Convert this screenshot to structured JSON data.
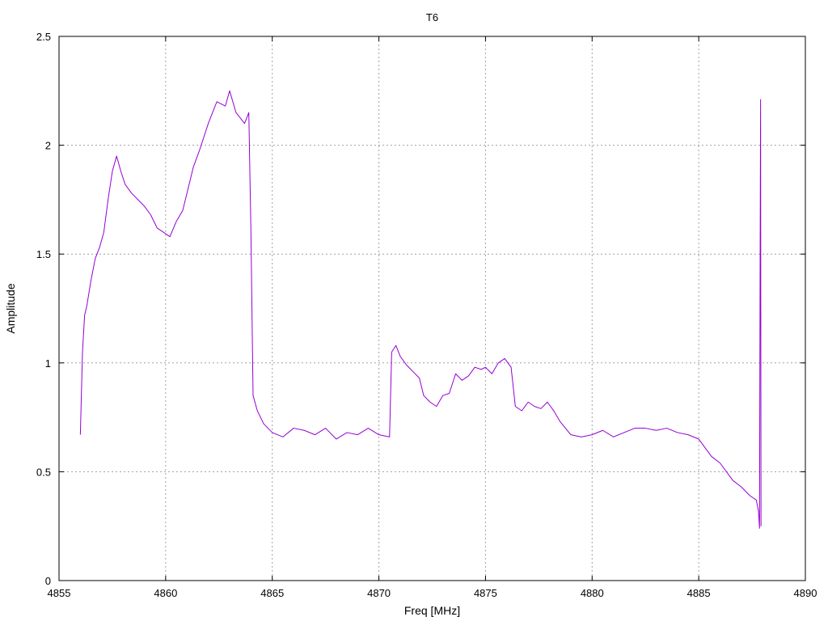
{
  "chart_data": {
    "type": "line",
    "title": "T6",
    "xlabel": "Freq [MHz]",
    "ylabel": "Amplitude",
    "xlim": [
      4855,
      4890
    ],
    "ylim": [
      0,
      2.5
    ],
    "xticks": [
      4855,
      4860,
      4865,
      4870,
      4875,
      4880,
      4885,
      4890
    ],
    "yticks": [
      0,
      0.5,
      1,
      1.5,
      2,
      2.5
    ],
    "xtick_labels": [
      "4855",
      "4860",
      "4865",
      "4870",
      "4875",
      "4880",
      "4885",
      "4890"
    ],
    "ytick_labels": [
      "0",
      "0.5",
      "1",
      "1.5",
      "2",
      "2.5"
    ],
    "grid": true,
    "legend": "none",
    "series": [
      {
        "color": "#9400d3",
        "x": [
          4856.0,
          4856.1,
          4856.2,
          4856.3,
          4856.5,
          4856.7,
          4856.9,
          4857.1,
          4857.3,
          4857.5,
          4857.7,
          4857.9,
          4858.1,
          4858.4,
          4858.7,
          4859.0,
          4859.3,
          4859.6,
          4859.9,
          4860.2,
          4860.5,
          4860.8,
          4861.0,
          4861.3,
          4861.6,
          4862.0,
          4862.4,
          4862.8,
          4863.0,
          4863.3,
          4863.7,
          4863.9,
          4864.0,
          4864.1,
          4864.3,
          4864.6,
          4865.0,
          4865.5,
          4866.0,
          4866.5,
          4867.0,
          4867.5,
          4868.0,
          4868.5,
          4869.0,
          4869.5,
          4870.0,
          4870.5,
          4870.6,
          4870.8,
          4871.0,
          4871.3,
          4871.6,
          4871.9,
          4872.1,
          4872.4,
          4872.7,
          4873.0,
          4873.3,
          4873.6,
          4873.9,
          4874.2,
          4874.5,
          4874.8,
          4875.0,
          4875.3,
          4875.6,
          4875.9,
          4876.2,
          4876.4,
          4876.7,
          4877.0,
          4877.3,
          4877.6,
          4877.9,
          4878.2,
          4878.5,
          4879.0,
          4879.5,
          4880.0,
          4880.5,
          4881.0,
          4881.5,
          4882.0,
          4882.5,
          4883.0,
          4883.5,
          4884.0,
          4884.5,
          4885.0,
          4885.3,
          4885.6,
          4886.0,
          4886.3,
          4886.6,
          4887.0,
          4887.4,
          4887.7,
          4887.8,
          4887.85,
          4887.88,
          4887.9,
          4887.92
        ],
        "values": [
          0.67,
          1.05,
          1.22,
          1.26,
          1.38,
          1.48,
          1.53,
          1.6,
          1.75,
          1.88,
          1.95,
          1.88,
          1.82,
          1.78,
          1.75,
          1.72,
          1.68,
          1.62,
          1.6,
          1.58,
          1.65,
          1.7,
          1.78,
          1.9,
          1.98,
          2.1,
          2.2,
          2.18,
          2.25,
          2.15,
          2.1,
          2.15,
          1.6,
          0.85,
          0.78,
          0.72,
          0.68,
          0.66,
          0.7,
          0.69,
          0.67,
          0.7,
          0.65,
          0.68,
          0.67,
          0.7,
          0.67,
          0.66,
          1.05,
          1.08,
          1.03,
          0.99,
          0.96,
          0.93,
          0.85,
          0.82,
          0.8,
          0.85,
          0.86,
          0.95,
          0.92,
          0.94,
          0.98,
          0.97,
          0.98,
          0.95,
          1.0,
          1.02,
          0.98,
          0.8,
          0.78,
          0.82,
          0.8,
          0.79,
          0.82,
          0.78,
          0.73,
          0.67,
          0.66,
          0.67,
          0.69,
          0.66,
          0.68,
          0.7,
          0.7,
          0.69,
          0.7,
          0.68,
          0.67,
          0.65,
          0.61,
          0.57,
          0.54,
          0.5,
          0.46,
          0.43,
          0.39,
          0.37,
          0.32,
          0.24,
          1.5,
          2.21,
          0.25
        ]
      }
    ]
  }
}
